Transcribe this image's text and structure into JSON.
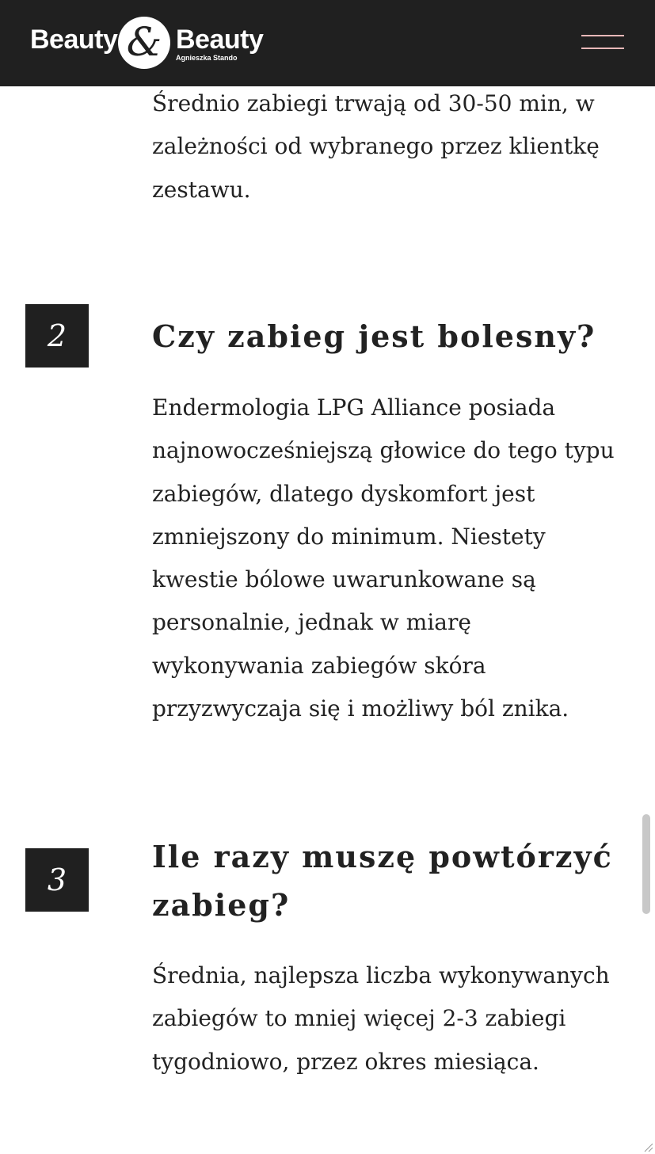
{
  "header": {
    "logo": {
      "word_left": "Beauty",
      "word_right": "Beauty",
      "ampersand": "&",
      "subtitle": "Agnieszka Stando"
    },
    "menu_icon": "hamburger-menu-icon",
    "colors": {
      "background": "#202020",
      "menu_lines": "#e8b8b8"
    }
  },
  "faq": {
    "intro_answer": "Średnio zabiegi trwają od 30-50 min, w zależności od wybranego przez klientkę zestawu.",
    "items": [
      {
        "number": "2",
        "question": "Czy zabieg jest bolesny?",
        "answer": "Endermologia LPG Alliance posiada najnowocześniejszą głowice do tego typu zabiegów, dlatego dyskomfort jest zmniejszony do minimum. Niestety kwestie bólowe uwarunkowane są personalnie, jednak w miarę wykonywania zabiegów skóra przyzwyczaja się i możliwy ból znika."
      },
      {
        "number": "3",
        "question": "Ile razy muszę powtórzyć zabieg?",
        "answer": "Średnia, najlepsza liczba wykonywanych zabiegów to mniej więcej 2-3 zabiegi tygodniowo, przez okres miesiąca."
      }
    ]
  }
}
